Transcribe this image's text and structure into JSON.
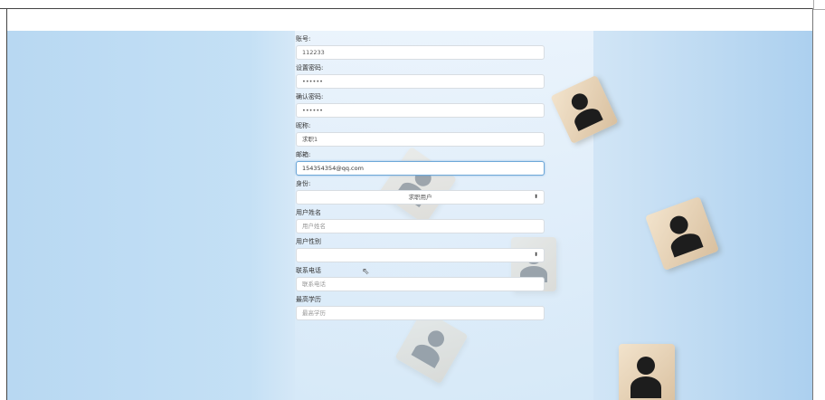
{
  "form": {
    "account_label": "账号:",
    "account_value": "112233",
    "password_label": "设置密码:",
    "password_value": "••••••",
    "confirm_label": "确认密码:",
    "confirm_value": "••••••",
    "nickname_label": "昵称:",
    "nickname_value": "求职1",
    "email_label": "邮箱:",
    "email_value": "154354354@qq.com",
    "role_label": "身份:",
    "role_value": "求职用户",
    "realname_label": "用户姓名",
    "realname_placeholder": "用户姓名",
    "gender_label": "用户性别",
    "gender_value": "",
    "phone_label": "联系电话",
    "phone_placeholder": "联系电话",
    "education_label": "最高学历",
    "education_placeholder": "最高学历"
  },
  "icons": {
    "select_caret": "updown-caret-icon",
    "mouse_cursor": "pointer-cursor-icon"
  },
  "colors": {
    "focus_border": "#6ea8d8",
    "background_blue": "#b8d8f2"
  }
}
